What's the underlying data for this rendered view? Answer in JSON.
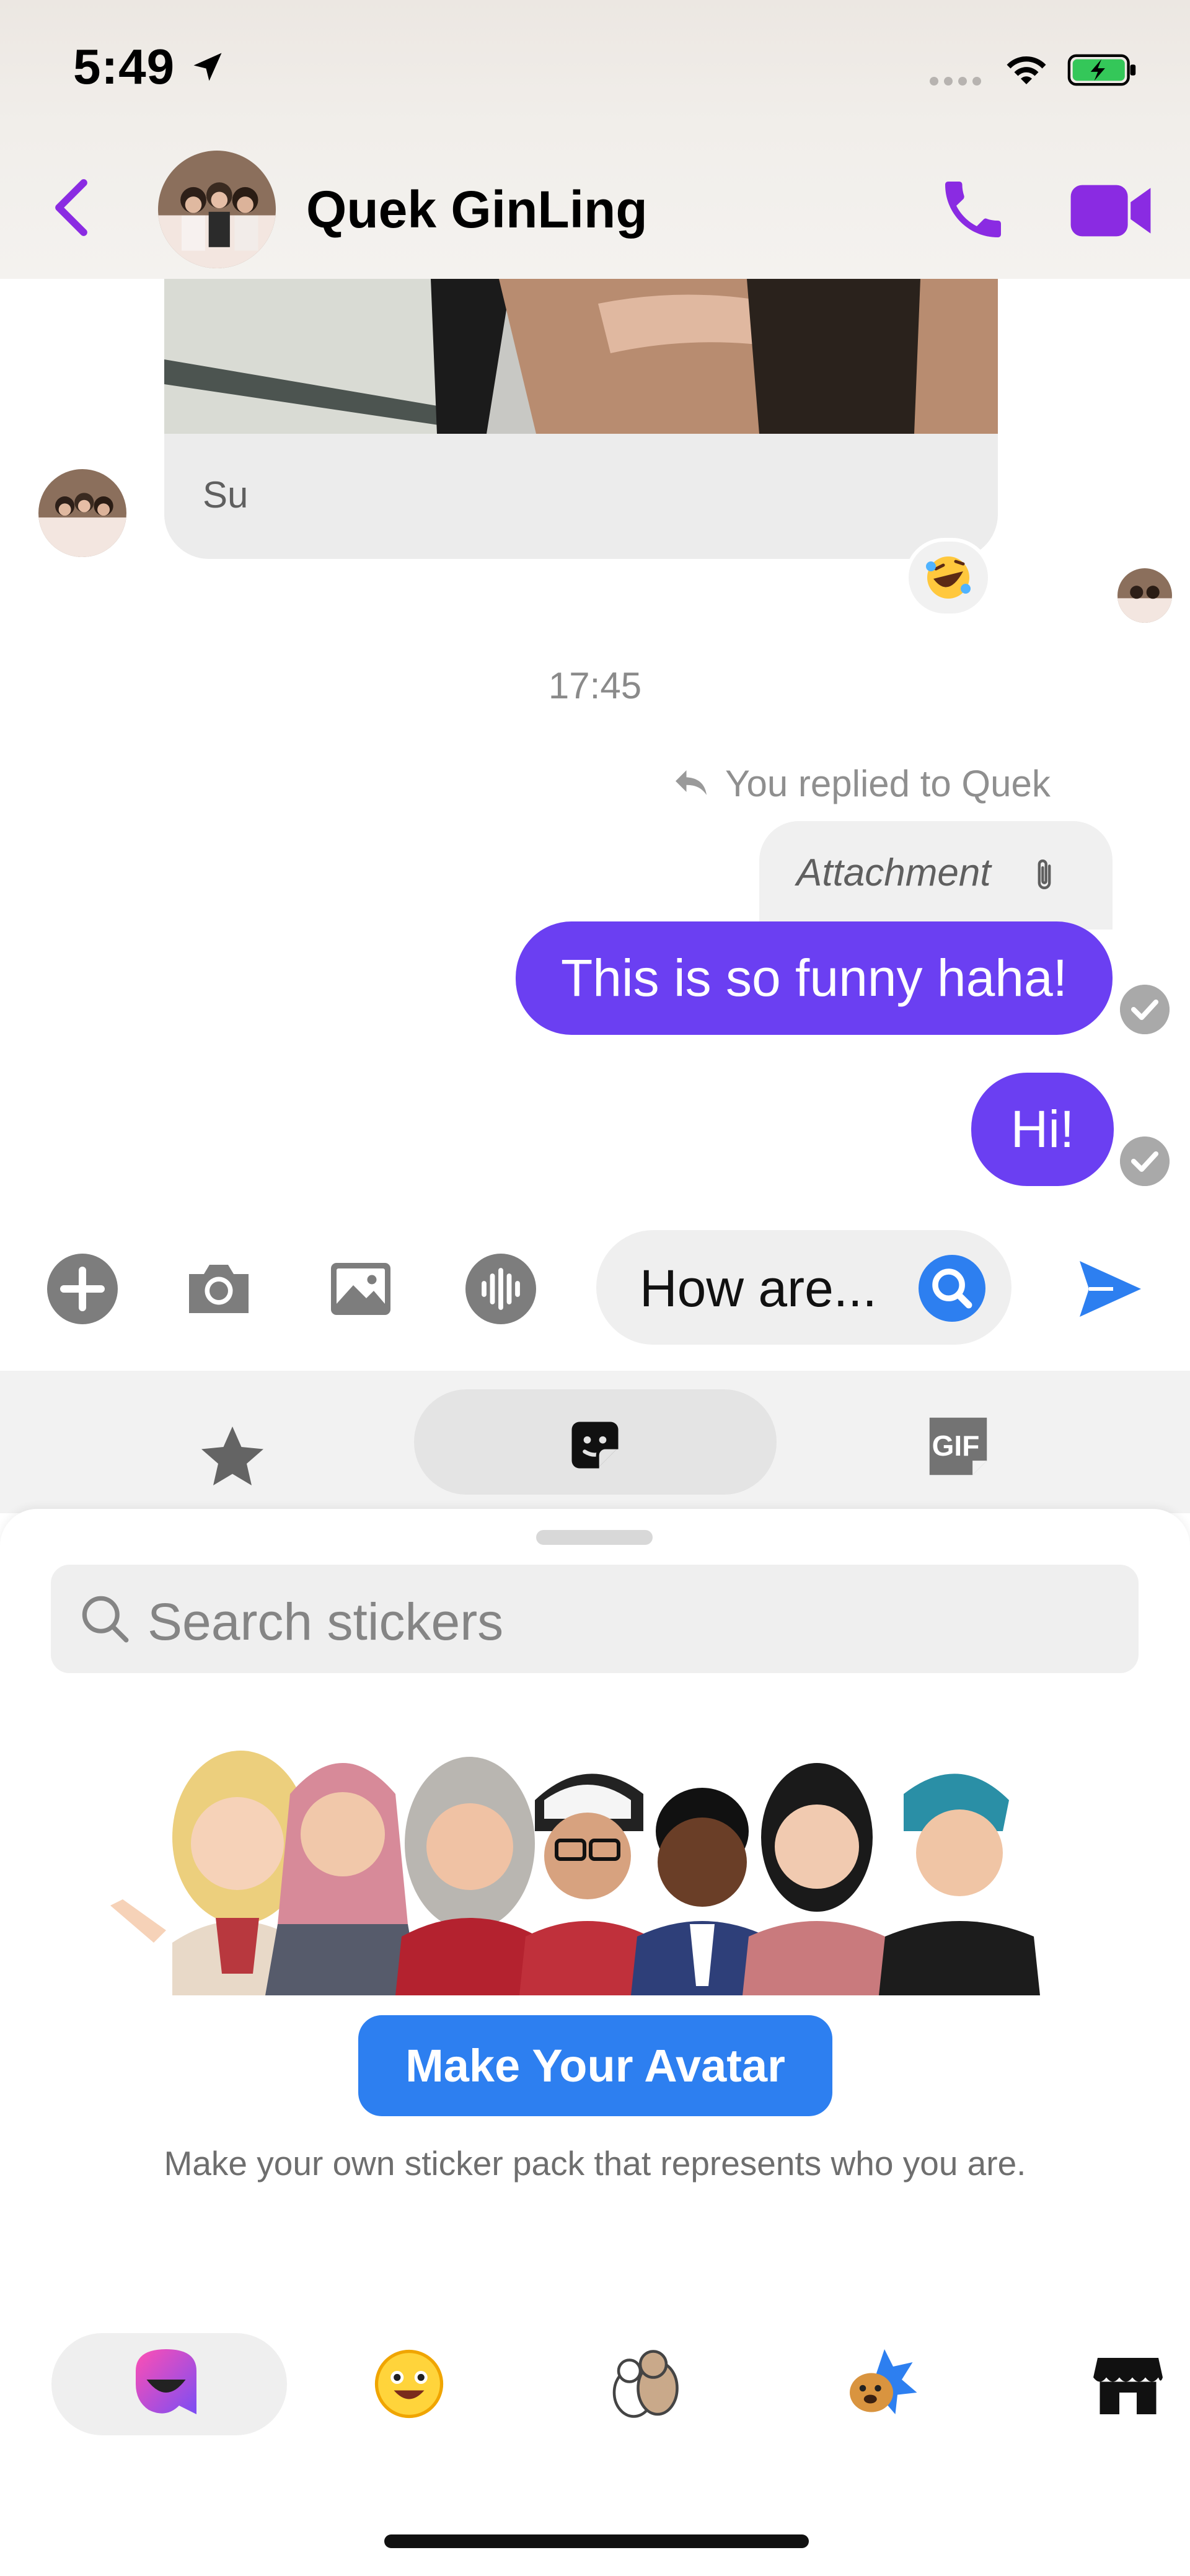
{
  "status_bar": {
    "time": "5:49"
  },
  "header": {
    "contact_name": "Quek GinLing"
  },
  "chat": {
    "photo_caption": "Su",
    "reaction_emoji": "🤣",
    "timestamp": "17:45",
    "replied_label": "You replied to Quek",
    "attachment_label": "Attachment",
    "messages": [
      {
        "text": "This is so funny haha!",
        "sender": "me"
      },
      {
        "text": "Hi!",
        "sender": "me"
      }
    ]
  },
  "composer": {
    "input_value": "How are..."
  },
  "sticker_tabs": [
    "favorites-star-icon",
    "sticker-icon",
    "gif-icon"
  ],
  "sticker_panel": {
    "search_placeholder": "Search stickers",
    "make_avatar_label": "Make Your Avatar",
    "make_avatar_subtitle": "Make your own sticker pack that represents who you are.",
    "gif_label": "GIF"
  },
  "colors": {
    "accent_purple": "#6b3ff2",
    "header_icon_purple": "#8a2be2",
    "primary_blue": "#2d7ff0",
    "battery_green": "#34c759"
  }
}
